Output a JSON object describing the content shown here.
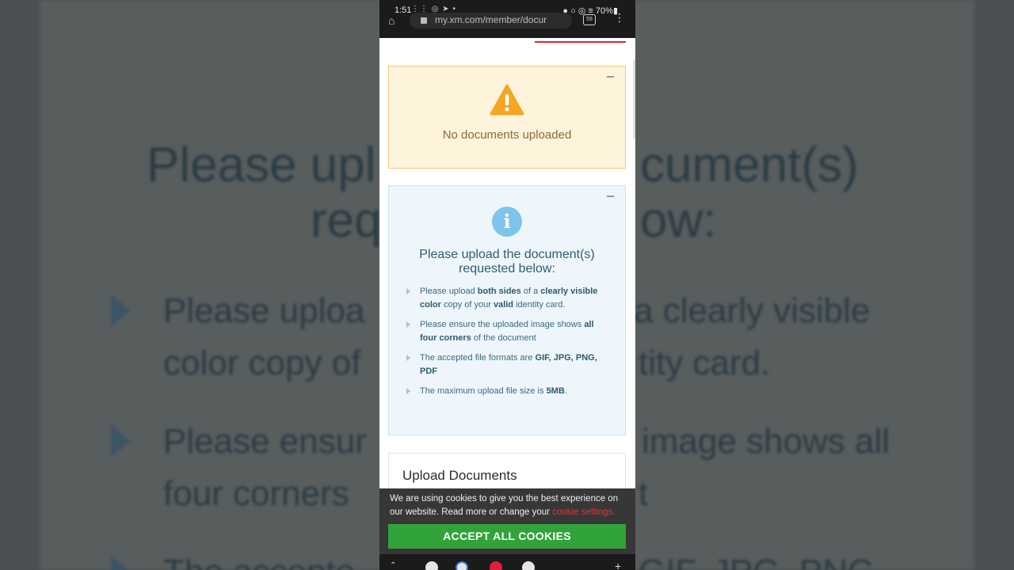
{
  "background": {
    "title_left": "Please upl",
    "title_right": "cument(s)",
    "title_line2_left": "req",
    "title_line2_right": "ow:",
    "line1_left": "Please uploa",
    "line1_right": "a clearly visible",
    "line2_left": "color copy of",
    "line2_right": "tity card.",
    "line3_left": "Please ensur",
    "line3_right": "image shows all",
    "line4_left": "four corners",
    "line4_right": "t",
    "line5_left": "The accepte",
    "line5_right": "GIF, JPG, PNG,"
  },
  "status_bar": {
    "time": "1:51",
    "battery": "70%",
    "url": "my.xm.com/member/docur",
    "tab_count": "59"
  },
  "warning_card": {
    "message": "No documents uploaded",
    "icon": "warning-icon",
    "color": "#f5a623"
  },
  "info_card": {
    "icon": "info-icon",
    "title": "Please upload the document(s) requested below:",
    "bullets": [
      {
        "pre": "Please upload ",
        "b1": "both sides",
        "mid1": " of a ",
        "b2": "clearly visible color",
        "mid2": " copy of your ",
        "b3": "valid",
        "post": " identity card."
      },
      {
        "pre": "Please ensure the uploaded image shows ",
        "b1": "all four corners",
        "post": " of the document"
      },
      {
        "pre": "The accepted file formats are ",
        "b1": "GIF, JPG, PNG, PDF"
      },
      {
        "pre": "The maximum upload file size is ",
        "b1": "5MB",
        "post": "."
      }
    ]
  },
  "upload_card": {
    "title": "Upload Documents"
  },
  "cookie_banner": {
    "text": "We are using cookies to give you the best experience on our website. Read more or change your ",
    "link": "cookie settings.",
    "accept_label": "ACCEPT ALL COOKIES",
    "accept_color": "#31a33a"
  }
}
